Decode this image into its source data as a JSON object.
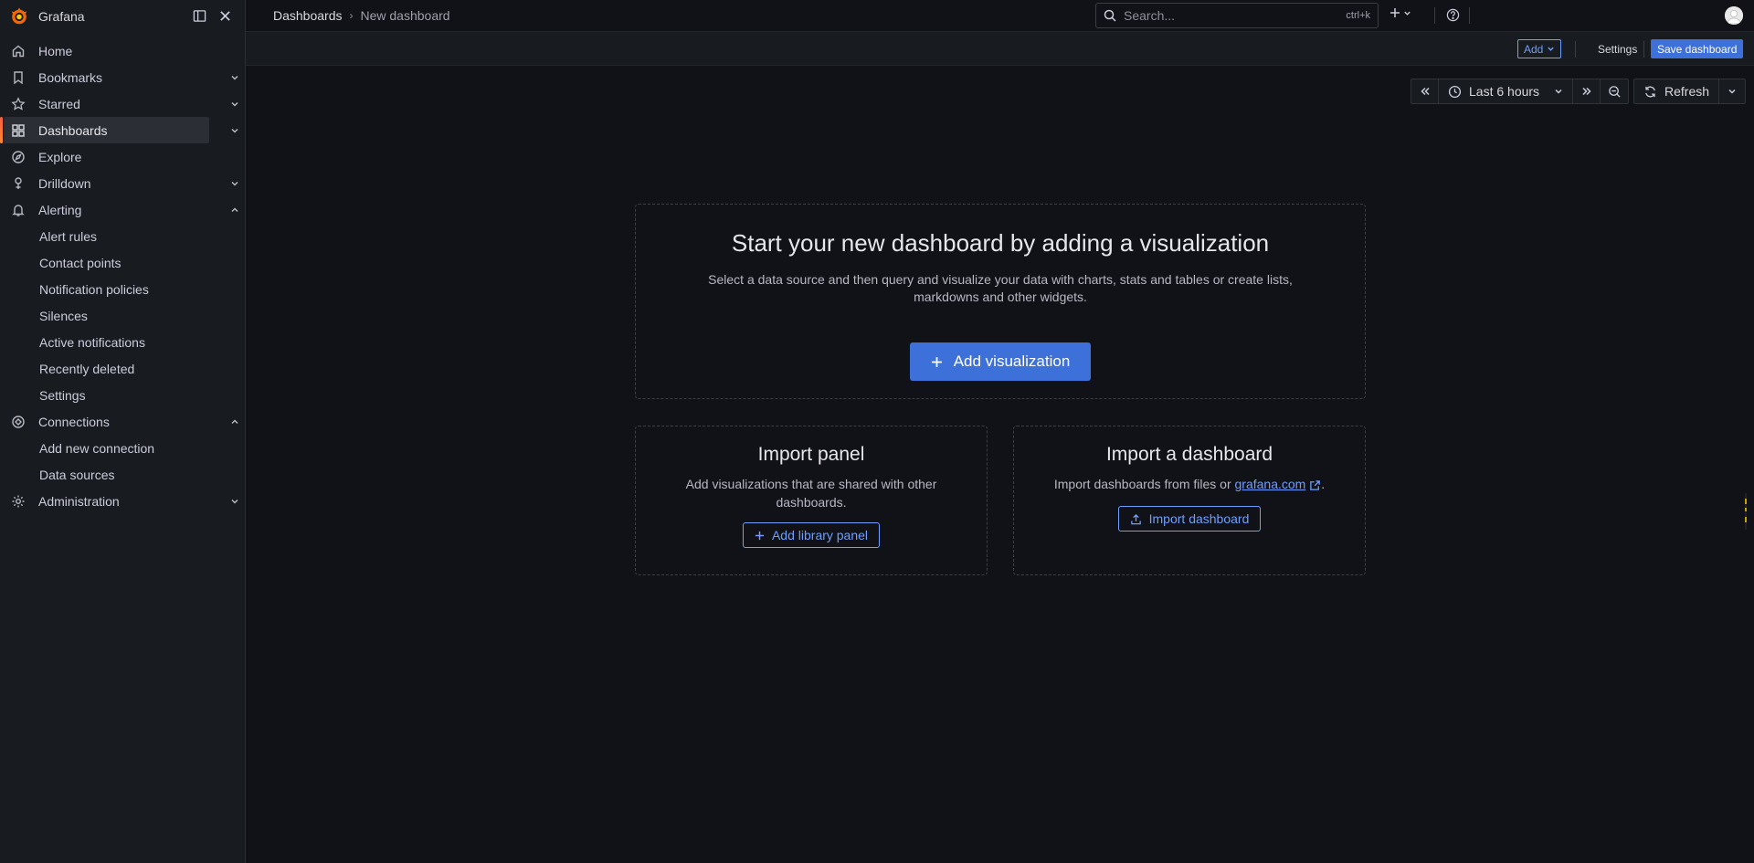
{
  "app": {
    "brand": "Grafana",
    "accent": "#f46800",
    "primary_blue": "#3d71d9",
    "link_blue": "#6e9fff"
  },
  "breadcrumb": {
    "parent": "Dashboards",
    "current": "New dashboard"
  },
  "search": {
    "placeholder": "Search...",
    "shortcut": "ctrl+k"
  },
  "toolbar": {
    "add_label": "Add",
    "settings_label": "Settings",
    "save_label": "Save dashboard"
  },
  "time": {
    "range_label": "Last 6 hours",
    "refresh_label": "Refresh"
  },
  "sidebar": {
    "items": [
      {
        "label": "Home",
        "icon": "home-icon",
        "chevron": ""
      },
      {
        "label": "Bookmarks",
        "icon": "bookmark-icon",
        "chevron": "down"
      },
      {
        "label": "Starred",
        "icon": "star-icon",
        "chevron": "down"
      },
      {
        "label": "Dashboards",
        "icon": "apps-icon",
        "chevron": "down",
        "active": true
      },
      {
        "label": "Explore",
        "icon": "compass-icon",
        "chevron": ""
      },
      {
        "label": "Drilldown",
        "icon": "drilldown-icon",
        "chevron": "down"
      },
      {
        "label": "Alerting",
        "icon": "bell-icon",
        "chevron": "up"
      },
      {
        "label": "Connections",
        "icon": "connections-icon",
        "chevron": "up"
      },
      {
        "label": "Administration",
        "icon": "gear-icon",
        "chevron": "down"
      }
    ],
    "alerting_children": [
      "Alert rules",
      "Contact points",
      "Notification policies",
      "Silences",
      "Active notifications",
      "Recently deleted",
      "Settings"
    ],
    "connections_children": [
      "Add new connection",
      "Data sources"
    ]
  },
  "empty_state": {
    "title": "Start your new dashboard by adding a visualization",
    "description": "Select a data source and then query and visualize your data with charts, stats and tables or create lists, markdowns and other widgets.",
    "add_visualization_label": "Add visualization"
  },
  "import_panel": {
    "title": "Import panel",
    "description": "Add visualizations that are shared with other dashboards.",
    "button_label": "Add library panel"
  },
  "import_dashboard": {
    "title": "Import a dashboard",
    "description_prefix": "Import dashboards from files or",
    "link_text": "grafana.com",
    "description_suffix": ".",
    "button_label": "Import dashboard"
  }
}
